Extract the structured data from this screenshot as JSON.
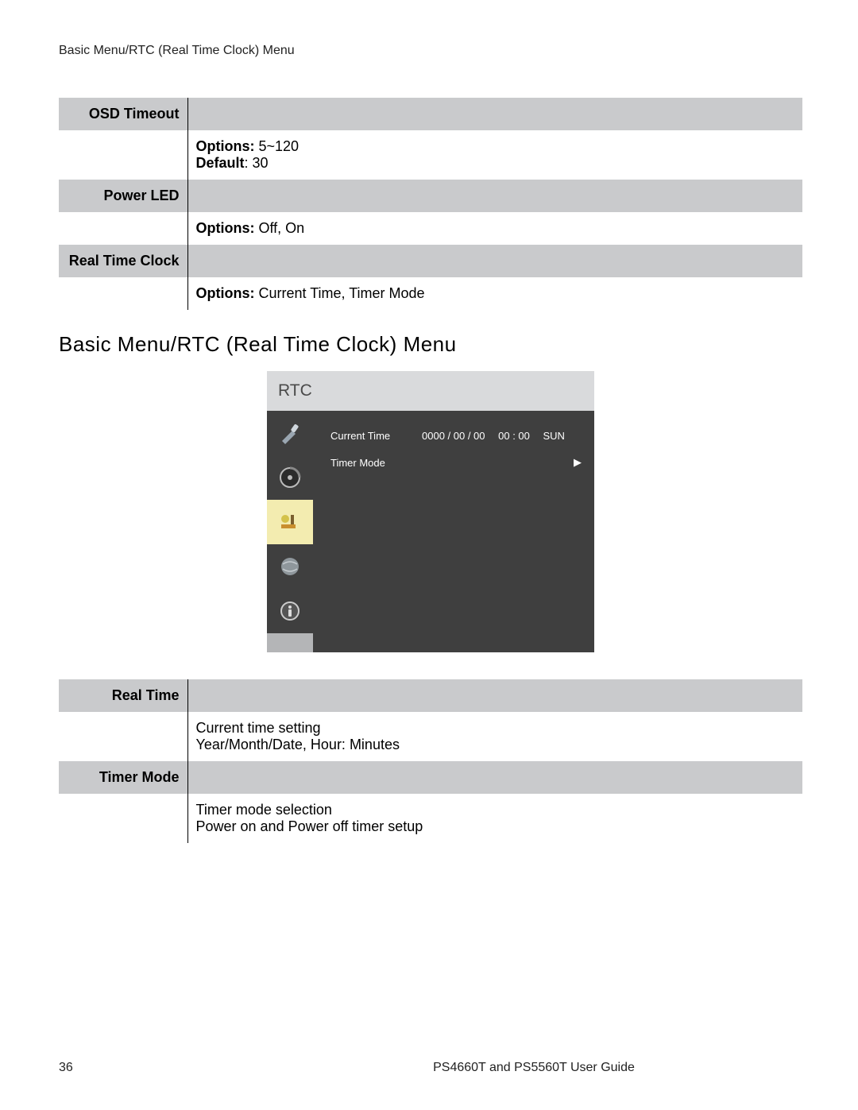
{
  "header": {
    "running": "Basic Menu/RTC (Real Time Clock) Menu"
  },
  "table1": {
    "rows": [
      {
        "label": "OSD Timeout",
        "shaded": true
      },
      {
        "label": "",
        "content_html": "<b>Options:</b> 5~120<br><b>Default</b>: 30"
      },
      {
        "label": "Power LED",
        "shaded": true
      },
      {
        "label": "",
        "content_html": "<b>Options:</b> Off, On"
      },
      {
        "label": "Real Time Clock",
        "shaded": true
      },
      {
        "label": "",
        "content_html": "<b>Options:</b> Current Time, Timer Mode"
      }
    ]
  },
  "section_title": "Basic Menu/RTC (Real Time Clock) Menu",
  "osd": {
    "title": "RTC",
    "items": [
      {
        "label": "Current Time",
        "value": "0000 / 00 / 00  00 : 00  SUN",
        "arrow": ""
      },
      {
        "label": "Timer Mode",
        "value": "",
        "arrow": "▶"
      }
    ],
    "icons": [
      {
        "name": "brush-icon",
        "sel": false
      },
      {
        "name": "cd-icon",
        "sel": false
      },
      {
        "name": "tools-icon",
        "sel": true
      },
      {
        "name": "globe-icon",
        "sel": false
      },
      {
        "name": "info-icon",
        "sel": false
      }
    ]
  },
  "table2": {
    "rows": [
      {
        "label": "Real Time",
        "shaded": true
      },
      {
        "label": "",
        "content_html": "Current time setting<br>Year/Month/Date, Hour: Minutes"
      },
      {
        "label": "Timer Mode",
        "shaded": true
      },
      {
        "label": "",
        "content_html": "Timer mode selection<br>Power on and Power off timer setup"
      }
    ]
  },
  "footer": {
    "page": "36",
    "doc": "PS4660T and PS5560T User Guide"
  }
}
